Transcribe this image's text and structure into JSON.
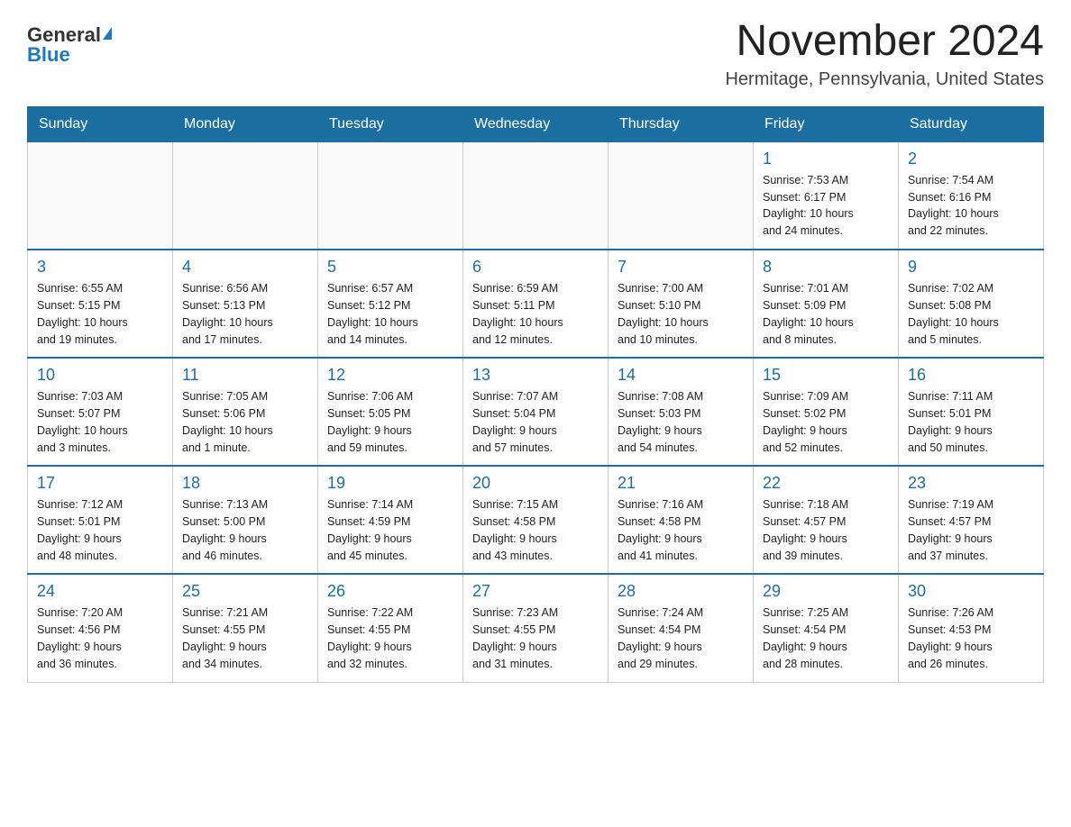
{
  "header": {
    "logo_general": "General",
    "logo_blue": "Blue",
    "title": "November 2024",
    "subtitle": "Hermitage, Pennsylvania, United States"
  },
  "days_of_week": [
    "Sunday",
    "Monday",
    "Tuesday",
    "Wednesday",
    "Thursday",
    "Friday",
    "Saturday"
  ],
  "weeks": [
    {
      "days": [
        {
          "number": "",
          "info": ""
        },
        {
          "number": "",
          "info": ""
        },
        {
          "number": "",
          "info": ""
        },
        {
          "number": "",
          "info": ""
        },
        {
          "number": "",
          "info": ""
        },
        {
          "number": "1",
          "info": "Sunrise: 7:53 AM\nSunset: 6:17 PM\nDaylight: 10 hours\nand 24 minutes."
        },
        {
          "number": "2",
          "info": "Sunrise: 7:54 AM\nSunset: 6:16 PM\nDaylight: 10 hours\nand 22 minutes."
        }
      ]
    },
    {
      "days": [
        {
          "number": "3",
          "info": "Sunrise: 6:55 AM\nSunset: 5:15 PM\nDaylight: 10 hours\nand 19 minutes."
        },
        {
          "number": "4",
          "info": "Sunrise: 6:56 AM\nSunset: 5:13 PM\nDaylight: 10 hours\nand 17 minutes."
        },
        {
          "number": "5",
          "info": "Sunrise: 6:57 AM\nSunset: 5:12 PM\nDaylight: 10 hours\nand 14 minutes."
        },
        {
          "number": "6",
          "info": "Sunrise: 6:59 AM\nSunset: 5:11 PM\nDaylight: 10 hours\nand 12 minutes."
        },
        {
          "number": "7",
          "info": "Sunrise: 7:00 AM\nSunset: 5:10 PM\nDaylight: 10 hours\nand 10 minutes."
        },
        {
          "number": "8",
          "info": "Sunrise: 7:01 AM\nSunset: 5:09 PM\nDaylight: 10 hours\nand 8 minutes."
        },
        {
          "number": "9",
          "info": "Sunrise: 7:02 AM\nSunset: 5:08 PM\nDaylight: 10 hours\nand 5 minutes."
        }
      ]
    },
    {
      "days": [
        {
          "number": "10",
          "info": "Sunrise: 7:03 AM\nSunset: 5:07 PM\nDaylight: 10 hours\nand 3 minutes."
        },
        {
          "number": "11",
          "info": "Sunrise: 7:05 AM\nSunset: 5:06 PM\nDaylight: 10 hours\nand 1 minute."
        },
        {
          "number": "12",
          "info": "Sunrise: 7:06 AM\nSunset: 5:05 PM\nDaylight: 9 hours\nand 59 minutes."
        },
        {
          "number": "13",
          "info": "Sunrise: 7:07 AM\nSunset: 5:04 PM\nDaylight: 9 hours\nand 57 minutes."
        },
        {
          "number": "14",
          "info": "Sunrise: 7:08 AM\nSunset: 5:03 PM\nDaylight: 9 hours\nand 54 minutes."
        },
        {
          "number": "15",
          "info": "Sunrise: 7:09 AM\nSunset: 5:02 PM\nDaylight: 9 hours\nand 52 minutes."
        },
        {
          "number": "16",
          "info": "Sunrise: 7:11 AM\nSunset: 5:01 PM\nDaylight: 9 hours\nand 50 minutes."
        }
      ]
    },
    {
      "days": [
        {
          "number": "17",
          "info": "Sunrise: 7:12 AM\nSunset: 5:01 PM\nDaylight: 9 hours\nand 48 minutes."
        },
        {
          "number": "18",
          "info": "Sunrise: 7:13 AM\nSunset: 5:00 PM\nDaylight: 9 hours\nand 46 minutes."
        },
        {
          "number": "19",
          "info": "Sunrise: 7:14 AM\nSunset: 4:59 PM\nDaylight: 9 hours\nand 45 minutes."
        },
        {
          "number": "20",
          "info": "Sunrise: 7:15 AM\nSunset: 4:58 PM\nDaylight: 9 hours\nand 43 minutes."
        },
        {
          "number": "21",
          "info": "Sunrise: 7:16 AM\nSunset: 4:58 PM\nDaylight: 9 hours\nand 41 minutes."
        },
        {
          "number": "22",
          "info": "Sunrise: 7:18 AM\nSunset: 4:57 PM\nDaylight: 9 hours\nand 39 minutes."
        },
        {
          "number": "23",
          "info": "Sunrise: 7:19 AM\nSunset: 4:57 PM\nDaylight: 9 hours\nand 37 minutes."
        }
      ]
    },
    {
      "days": [
        {
          "number": "24",
          "info": "Sunrise: 7:20 AM\nSunset: 4:56 PM\nDaylight: 9 hours\nand 36 minutes."
        },
        {
          "number": "25",
          "info": "Sunrise: 7:21 AM\nSunset: 4:55 PM\nDaylight: 9 hours\nand 34 minutes."
        },
        {
          "number": "26",
          "info": "Sunrise: 7:22 AM\nSunset: 4:55 PM\nDaylight: 9 hours\nand 32 minutes."
        },
        {
          "number": "27",
          "info": "Sunrise: 7:23 AM\nSunset: 4:55 PM\nDaylight: 9 hours\nand 31 minutes."
        },
        {
          "number": "28",
          "info": "Sunrise: 7:24 AM\nSunset: 4:54 PM\nDaylight: 9 hours\nand 29 minutes."
        },
        {
          "number": "29",
          "info": "Sunrise: 7:25 AM\nSunset: 4:54 PM\nDaylight: 9 hours\nand 28 minutes."
        },
        {
          "number": "30",
          "info": "Sunrise: 7:26 AM\nSunset: 4:53 PM\nDaylight: 9 hours\nand 26 minutes."
        }
      ]
    }
  ]
}
